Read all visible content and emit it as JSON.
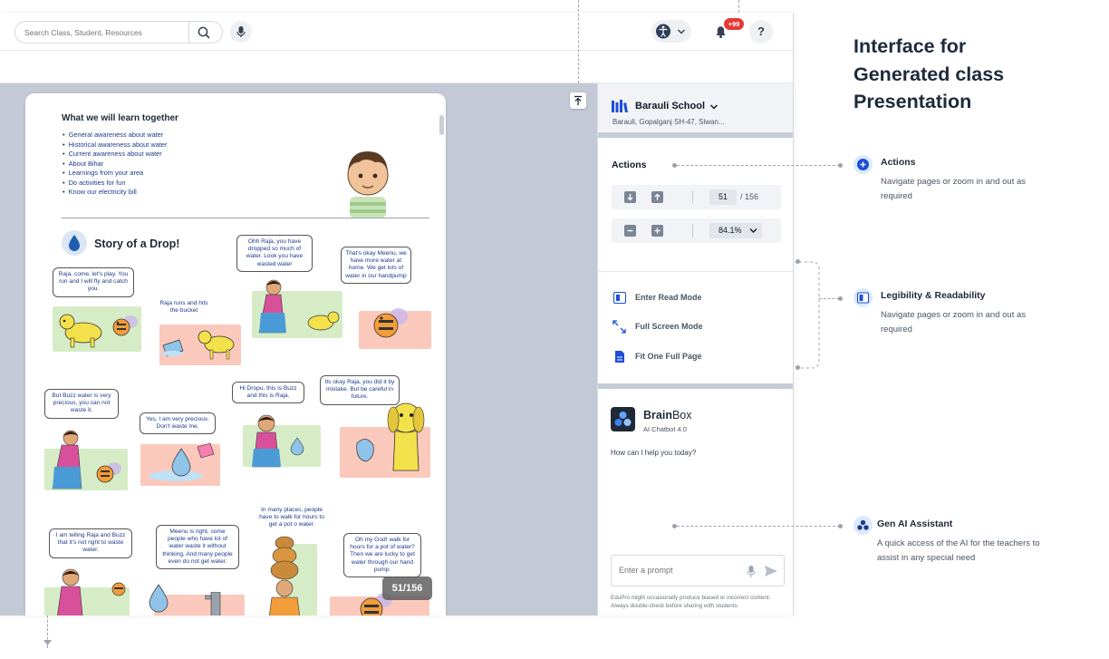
{
  "topbar": {
    "search_placeholder": "Search Class, Student, Resources",
    "notification_count": "+99",
    "help_label": "?"
  },
  "viewer": {
    "page_counter": "51/156",
    "learn": {
      "title": "What we will learn together",
      "items": [
        "General awareness about water",
        "Historical awareness about water",
        "Current awareness about water",
        "About Bihar",
        "Learnings from your area",
        "Do activities for fun",
        "Know our electricity bill"
      ]
    },
    "story": {
      "title": "Story of a Drop!",
      "bubbles": [
        "Raja, come, let's play. You run and I will fly and catch you.",
        "Raja runs and hits the bucket",
        "Ohh Raja, you have dropped so much of water. Look you have wasted water",
        "That's okay Meenu, we have more water at home. We get lots of water in our handpump",
        "But Buzz water is very precious, you can not waste it.",
        "Yes, I am very precious. Don't waste me.",
        "Hi Dropu, this is Buzz and this is Raja.",
        "Its okay Raja, you did it by mistake. But be careful in future.",
        "I am telling Raja and Buzz that it's not right to waste water.",
        "Meenu is right, some people who have lot of water waste it without thinking. And many people even do not get water.",
        "In many places, people have to walk for hours to get a pot o water.",
        "Oh my God! walk for hours for a pot of water? Then we are lucky to get water through our hand pump."
      ]
    }
  },
  "sidebar": {
    "school_name": "Barauli School",
    "school_address": "Barauli, Gopalganj SH-47, Siwan...",
    "actions_title": "Actions",
    "current_page": "51",
    "total_pages": "/ 156",
    "zoom": "84.1%",
    "modes": [
      "Enter Read Mode",
      "Full Screen Mode",
      "Fit One Full Page"
    ],
    "brainbox": {
      "name_bold": "Brain",
      "name_rest": "Box",
      "subtitle": "AI Chatbot 4.0",
      "greeting": "How can I help you today?",
      "prompt_placeholder": "Enter a prompt",
      "disclaimer": "EduPro might occasionally produce biased or incorrect content. Always double-check before sharing with students."
    }
  },
  "annotations": {
    "title": "Interface for Generated class Presentation",
    "items": [
      {
        "title": "Actions",
        "desc": "Navigate pages or zoom in and out as required",
        "icon": "plus-circle-icon"
      },
      {
        "title": "Legibility & Readability",
        "desc": "Navigate pages or zoom in and out as required",
        "icon": "read-mode-icon"
      },
      {
        "title": "Gen AI Assistant",
        "desc": "A quick access of the AI for the teachers to assist in any special need",
        "icon": "ai-assistant-icon"
      }
    ]
  },
  "colors": {
    "accent": "#1d4ed8",
    "badge": "#e53935",
    "viewer_bg": "#c3cad5"
  }
}
